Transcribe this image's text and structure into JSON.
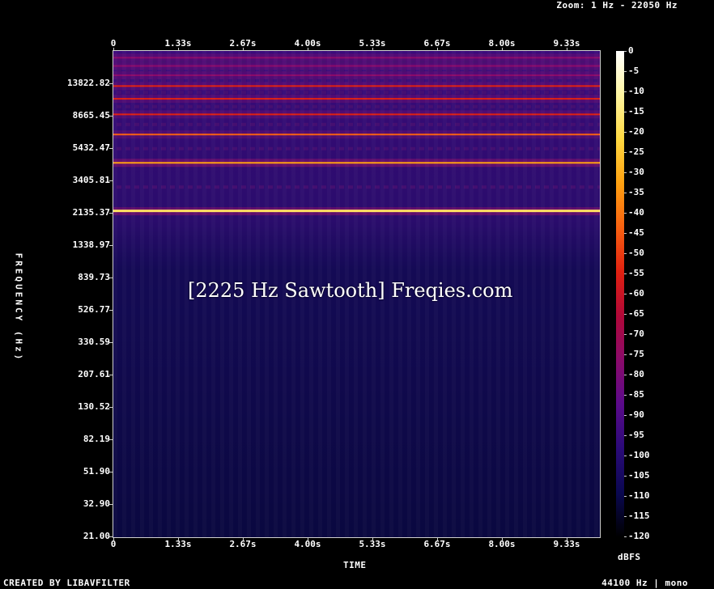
{
  "header": {
    "zoom": "Zoom: 1 Hz - 22050 Hz"
  },
  "footer": {
    "created": "CREATED BY LIBAVFILTER",
    "meta": "44100 Hz | mono"
  },
  "watermark": "[2225 Hz Sawtooth] Freqies.com",
  "chart_data": {
    "type": "heatmap",
    "title": "",
    "xlabel": "TIME",
    "ylabel": "FREQUENCY (Hz)",
    "x_ticks": [
      "0",
      "1.33s",
      "2.67s",
      "4.00s",
      "5.33s",
      "6.67s",
      "8.00s",
      "9.33s"
    ],
    "x_range_s": [
      0,
      10
    ],
    "y_ticks": [
      "13822.82",
      "8665.45",
      "5432.47",
      "3405.81",
      "2135.37",
      "1338.97",
      "839.73",
      "526.77",
      "330.59",
      "207.61",
      "130.52",
      "82.19",
      "51.90",
      "32.90",
      "21.00"
    ],
    "y_scale": "log",
    "y_range_hz": [
      21,
      22050
    ],
    "colorbar": {
      "unit": "dBFS",
      "ticks": [
        "0",
        "-5",
        "-10",
        "-15",
        "-20",
        "-25",
        "-30",
        "-35",
        "-40",
        "-45",
        "-50",
        "-55",
        "-60",
        "-65",
        "-70",
        "-75",
        "-80",
        "-85",
        "-90",
        "-95",
        "-100",
        "-105",
        "-110",
        "-115",
        "-120"
      ],
      "range_db": [
        -120,
        0
      ]
    },
    "harmonics_hz": [
      2225,
      4450,
      6675,
      8900,
      11125,
      13350,
      15575,
      17800,
      20025
    ],
    "harmonic_levels_dbfs": [
      -20,
      -35,
      -45,
      -55,
      -60,
      -65,
      -70,
      -75,
      -78
    ],
    "colors": {
      "background": "#0a0840",
      "colormap": [
        "#000000",
        "#0a0840",
        "#2a0a70",
        "#6a0a8a",
        "#a01070",
        "#d02030",
        "#f05010",
        "#fca010",
        "#fff060",
        "#ffffff"
      ]
    }
  }
}
